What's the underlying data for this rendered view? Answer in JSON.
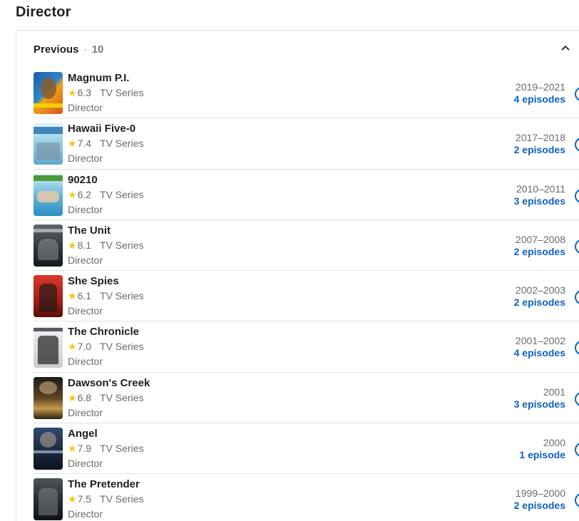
{
  "section": {
    "title": "Director"
  },
  "card": {
    "header_label": "Previous",
    "header_sep": "·",
    "header_count": "10"
  },
  "colors": {
    "accent": "#0e63be",
    "star": "#f5c518",
    "divider": "#e2e2e2",
    "muted_text": "#6b6b6b"
  },
  "icons": {
    "collapse": "chevron-up-icon",
    "info": "info-circle-icon",
    "rating": "star-icon"
  },
  "credits": [
    {
      "title": "Magnum P.I.",
      "star": "★",
      "rating": "6.3",
      "kind": "TV Series",
      "role": "Director",
      "years": "2019–2021",
      "episodes": "4 episodes"
    },
    {
      "title": "Hawaii Five-0",
      "star": "★",
      "rating": "7.4",
      "kind": "TV Series",
      "role": "Director",
      "years": "2017–2018",
      "episodes": "2 episodes"
    },
    {
      "title": "90210",
      "star": "★",
      "rating": "6.2",
      "kind": "TV Series",
      "role": "Director",
      "years": "2010–2011",
      "episodes": "3 episodes"
    },
    {
      "title": "The Unit",
      "star": "★",
      "rating": "8.1",
      "kind": "TV Series",
      "role": "Director",
      "years": "2007–2008",
      "episodes": "2 episodes"
    },
    {
      "title": "She Spies",
      "star": "★",
      "rating": "6.1",
      "kind": "TV Series",
      "role": "Director",
      "years": "2002–2003",
      "episodes": "2 episodes"
    },
    {
      "title": "The Chronicle",
      "star": "★",
      "rating": "7.0",
      "kind": "TV Series",
      "role": "Director",
      "years": "2001–2002",
      "episodes": "4 episodes"
    },
    {
      "title": "Dawson's Creek",
      "star": "★",
      "rating": "6.8",
      "kind": "TV Series",
      "role": "Director",
      "years": "2001",
      "episodes": "3 episodes"
    },
    {
      "title": "Angel",
      "star": "★",
      "rating": "7.9",
      "kind": "TV Series",
      "role": "Director",
      "years": "2000",
      "episodes": "1 episode"
    },
    {
      "title": "The Pretender",
      "star": "★",
      "rating": "7.5",
      "kind": "TV Series",
      "role": "Director",
      "years": "1999–2000",
      "episodes": "2 episodes"
    }
  ]
}
